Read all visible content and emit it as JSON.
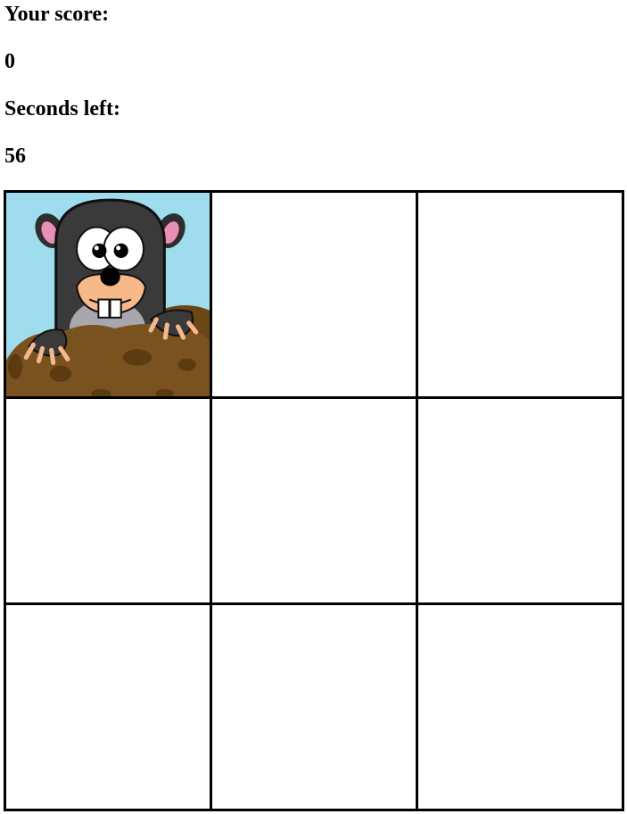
{
  "score": {
    "label": "Your score:",
    "value": "0"
  },
  "timer": {
    "label": "Seconds left:",
    "value": "56"
  },
  "board": {
    "rows": 3,
    "cols": 3,
    "mole_square_index": 0,
    "mole_icon": "mole-icon",
    "colors": {
      "sky": "#9fdcee",
      "mole": "#3a3a3a",
      "snout": "#f7b98a",
      "dirt": "#7a5220",
      "grid_line": "#000000"
    }
  }
}
